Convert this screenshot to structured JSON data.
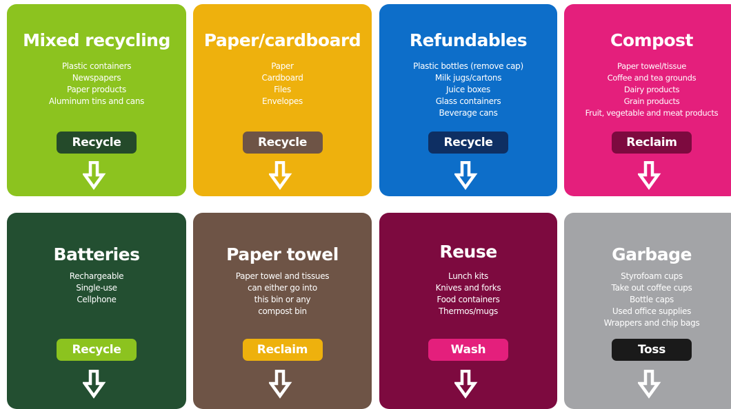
{
  "cards": [
    {
      "title": "Mixed recycling",
      "items": [
        "Plastic containers",
        "Newspapers",
        "Paper products",
        "Aluminum tins and cans"
      ],
      "action": "Recycle",
      "color": "#8cc31f",
      "action_color": "#244a2a"
    },
    {
      "title": "Paper/cardboard",
      "items": [
        "Paper",
        "Cardboard",
        "Files",
        "Envelopes"
      ],
      "action": "Recycle",
      "color": "#eeb10d",
      "action_color": "#6e5446"
    },
    {
      "title": "Refundables",
      "items": [
        "Plastic bottles (remove cap)",
        "Milk jugs/cartons",
        "Juice boxes",
        "Glass containers",
        "Beverage cans"
      ],
      "action": "Recycle",
      "color": "#0d6ec9",
      "action_color": "#0e2f63"
    },
    {
      "title": "Compost",
      "items": [
        "Paper towel/tissue",
        "Coffee and tea grounds",
        "Dairy products",
        "Grain products",
        "Fruit, vegetable and meat products"
      ],
      "action": "Reclaim",
      "color": "#e41f7c",
      "action_color": "#7d0a3f"
    },
    {
      "title": "Batteries",
      "items": [
        "Rechargeable",
        "Single-use",
        "Cellphone"
      ],
      "action": "Recycle",
      "color": "#234f31",
      "action_color": "#8cc31f"
    },
    {
      "title": "Paper towel",
      "items": [
        "Paper towel and tissues",
        "can either go into",
        "this bin or any",
        "compost bin"
      ],
      "action": "Reclaim",
      "color": "#6e5446",
      "action_color": "#eeb10d"
    },
    {
      "title": "Reuse",
      "items": [
        "Lunch kits",
        "Knives and forks",
        "Food containers",
        "Thermos/mugs"
      ],
      "action": "Wash",
      "color": "#7d0a3f",
      "action_color": "#e41f7c"
    },
    {
      "title": "Garbage",
      "items": [
        "Styrofoam cups",
        "Take out coffee cups",
        "Bottle caps",
        "Used office supplies",
        "Wrappers and chip bags"
      ],
      "action": "Toss",
      "color": "#a3a4a7",
      "action_color": "#1a1a1a"
    }
  ],
  "icons": {
    "arrow": "down-arrow-icon"
  }
}
